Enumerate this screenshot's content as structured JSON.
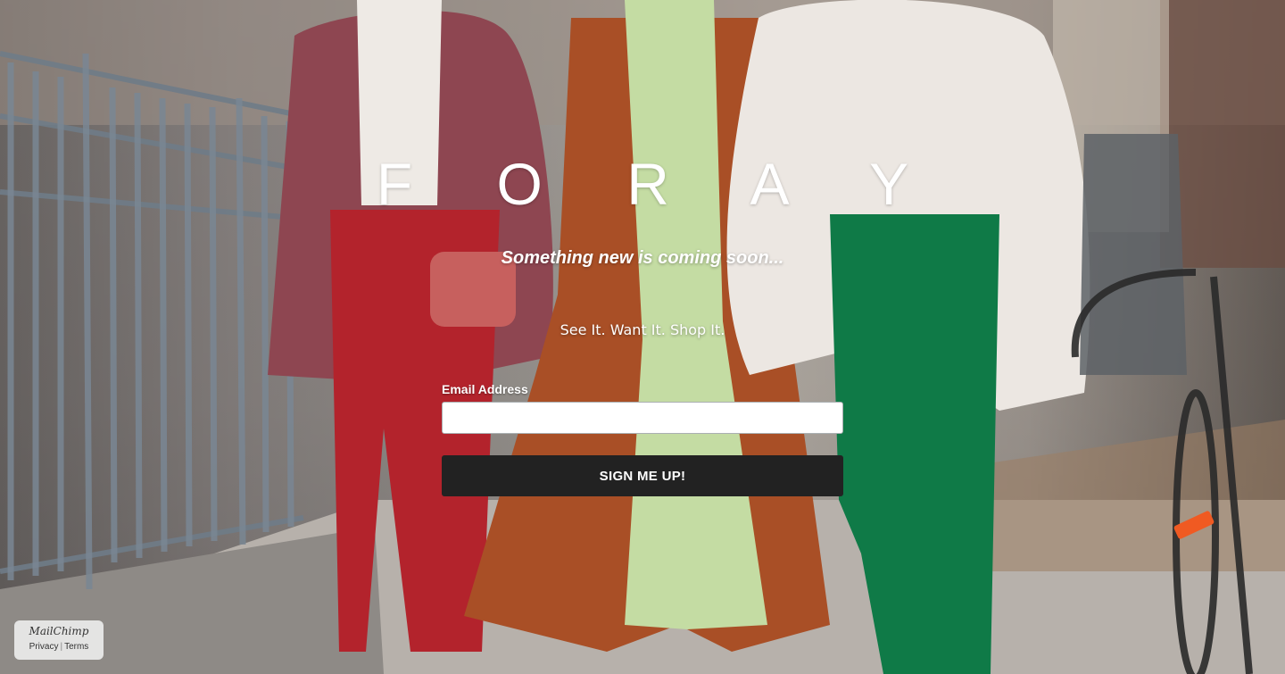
{
  "page": {
    "brand": "F O R A Y",
    "tagline": "Something new is coming soon...",
    "motto": "See It. Want It. Shop It."
  },
  "form": {
    "email_label": "Email Address",
    "email_value": "",
    "submit_label": "SIGN ME UP!"
  },
  "footer_badge": {
    "logo": "MailChimp",
    "privacy_label": "Privacy",
    "separator": "|",
    "terms_label": "Terms"
  },
  "colors": {
    "button_bg": "#222222",
    "button_text": "#ffffff",
    "text": "#ffffff"
  }
}
